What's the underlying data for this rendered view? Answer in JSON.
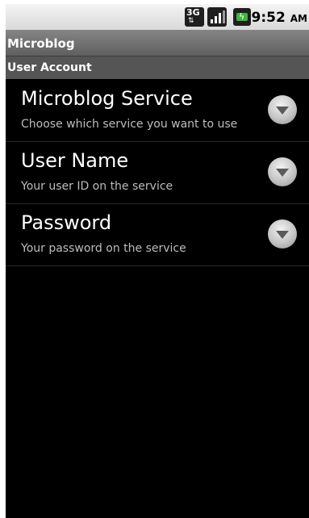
{
  "status_bar": {
    "network_label": "3G",
    "time": "9:52",
    "ampm": "AM",
    "icons": [
      "3g-network-icon",
      "signal-strength-icon",
      "battery-charging-icon"
    ]
  },
  "app": {
    "title": "Microblog"
  },
  "category": {
    "title": "User Account"
  },
  "preferences": [
    {
      "title": "Microblog Service",
      "summary": "Choose which service you want to use"
    },
    {
      "title": "User Name",
      "summary": "Your user ID on the service"
    },
    {
      "title": "Password",
      "summary": "Your password on the service"
    }
  ],
  "colors": {
    "background": "#000000",
    "title_bar": "#6e6e6e",
    "category_header": "#555555",
    "battery": "#3fb33f"
  }
}
